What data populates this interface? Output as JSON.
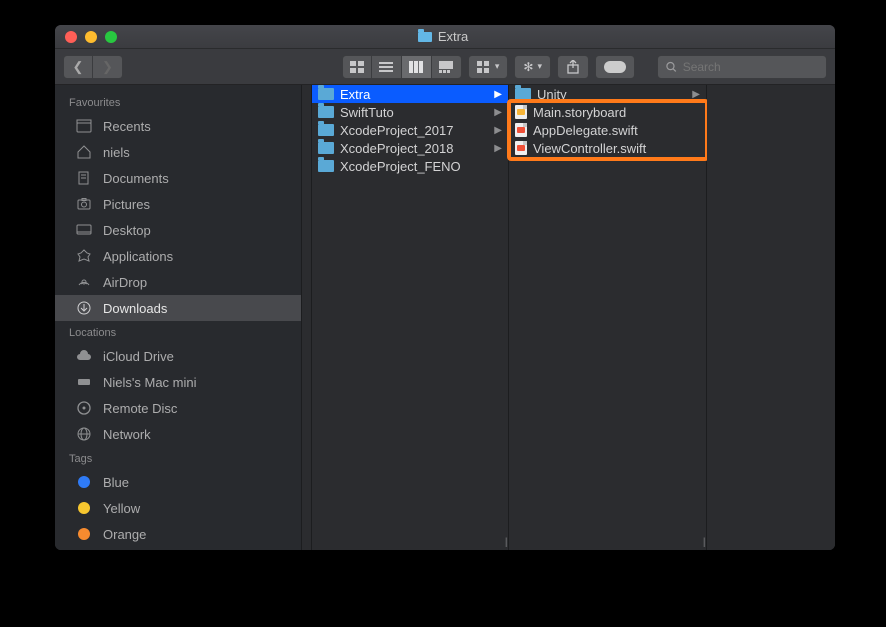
{
  "window": {
    "title": "Extra"
  },
  "toolbar": {
    "back_enabled": true,
    "forward_enabled": false,
    "search_placeholder": "Search"
  },
  "sidebar": {
    "sections": [
      {
        "label": "Favourites",
        "items": [
          {
            "icon": "recents",
            "label": "Recents"
          },
          {
            "icon": "home",
            "label": "niels"
          },
          {
            "icon": "documents",
            "label": "Documents"
          },
          {
            "icon": "pictures",
            "label": "Pictures"
          },
          {
            "icon": "desktop",
            "label": "Desktop"
          },
          {
            "icon": "applications",
            "label": "Applications"
          },
          {
            "icon": "airdrop",
            "label": "AirDrop"
          },
          {
            "icon": "downloads",
            "label": "Downloads",
            "selected": true
          }
        ]
      },
      {
        "label": "Locations",
        "items": [
          {
            "icon": "icloud",
            "label": "iCloud Drive"
          },
          {
            "icon": "computer",
            "label": "Niels's Mac mini"
          },
          {
            "icon": "disc",
            "label": "Remote Disc"
          },
          {
            "icon": "network",
            "label": "Network"
          }
        ]
      },
      {
        "label": "Tags",
        "items": [
          {
            "icon": "tag",
            "color": "#2f7bf6",
            "label": "Blue"
          },
          {
            "icon": "tag",
            "color": "#f6c62f",
            "label": "Yellow"
          },
          {
            "icon": "tag",
            "color": "#f78b2f",
            "label": "Orange"
          }
        ]
      }
    ]
  },
  "columns": {
    "col2": [
      {
        "type": "folder",
        "label": "Extra",
        "has_children": true,
        "selected": true
      },
      {
        "type": "folder",
        "label": "SwiftTuto",
        "has_children": true
      },
      {
        "type": "folder",
        "label": "XcodeProject_2017",
        "has_children": true
      },
      {
        "type": "folder",
        "label": "XcodeProject_2018",
        "has_children": true
      },
      {
        "type": "folder",
        "label": "XcodeProject_FENO"
      }
    ],
    "col3": [
      {
        "type": "folder",
        "label": "Unity",
        "has_children": true
      },
      {
        "type": "doc-sb",
        "label": "Main.storyboard"
      },
      {
        "type": "doc-swift",
        "label": "AppDelegate.swift"
      },
      {
        "type": "doc-swift",
        "label": "ViewController.swift"
      }
    ]
  }
}
